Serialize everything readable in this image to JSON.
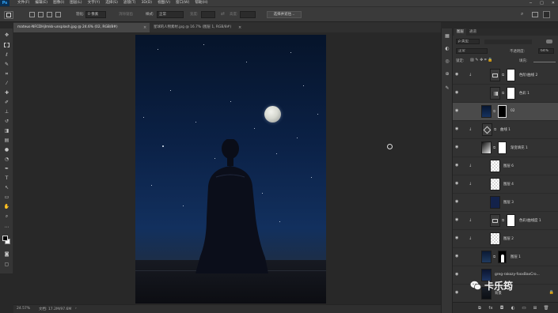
{
  "app": {
    "logo": "Ps"
  },
  "menu": [
    "文件(F)",
    "编辑(E)",
    "图像(I)",
    "图层(L)",
    "文字(Y)",
    "选择(S)",
    "滤镜(T)",
    "3D(D)",
    "视图(V)",
    "窗口(W)",
    "帮助(H)"
  ],
  "window_controls": [
    "─",
    "□",
    "✕"
  ],
  "options": {
    "feather_label": "羽化:",
    "feather_value": "0 像素",
    "antialias_label": "消除锯齿",
    "style_label": "样式:",
    "style_value": "正常",
    "width_label": "宽度:",
    "height_label": "高度:",
    "select_mask_button": "选择并遮住..."
  },
  "tabs": [
    {
      "title": "mateus-NFCDHjlmkk-unsplash.jpg @ 24.6% (02, RGB/8#)",
      "close": "×"
    },
    {
      "title": "星球的人物素材.jpg @ 16.7% (图层 1, RGB/8#)",
      "close": "×"
    }
  ],
  "status": {
    "zoom": "24.57%",
    "doc": "文档: 17.2M/97.6M",
    "arrow": "›"
  },
  "panel": {
    "tabs": [
      "图层",
      "通道"
    ],
    "kind_filter": "ρ 类型",
    "blend_mode": "正常",
    "opacity_label": "不透明度:",
    "opacity_value": "64%",
    "lock_label": "锁定:",
    "fill_label": "填充:",
    "fill_value": "100%",
    "layers": [
      {
        "name": "色阶/曲线 2",
        "thumb": "adjust",
        "mask": "white",
        "clip": "↓",
        "selected": false
      },
      {
        "name": "色彩 1",
        "thumb": "adjust2",
        "mask": "white",
        "clip": "",
        "selected": false
      },
      {
        "name": "02",
        "thumb": "photo",
        "mask": "black",
        "clip": "",
        "selected": true
      },
      {
        "name": "曲线 1",
        "thumb": "adjust",
        "mask": "",
        "clip": "↓",
        "selected": false
      },
      {
        "name": "渐变填充 1",
        "thumb": "gradient",
        "mask": "white",
        "clip": "",
        "selected": false
      },
      {
        "name": "图层 6",
        "thumb": "checker",
        "mask": "",
        "clip": "↓",
        "selected": false
      },
      {
        "name": "图层 4",
        "thumb": "checker",
        "mask": "",
        "clip": "↓",
        "selected": false
      },
      {
        "name": "图层 3",
        "thumb": "navy",
        "mask": "",
        "clip": "",
        "selected": false
      },
      {
        "name": "色彩/曲线度 1",
        "thumb": "adjust",
        "mask": "white",
        "clip": "↓",
        "selected": false
      },
      {
        "name": "图层 2",
        "thumb": "checker",
        "mask": "",
        "clip": "↓",
        "selected": false
      },
      {
        "name": "图层 1",
        "thumb": "figure",
        "mask": "figure",
        "clip": "",
        "selected": false
      },
      {
        "name": "greg-rakozy-foxxBaxCro...",
        "thumb": "sky",
        "mask": "",
        "clip": "",
        "selected": false
      },
      {
        "name": "背景",
        "thumb": "dark",
        "mask": "",
        "clip": "",
        "selected": false,
        "locked": true
      }
    ],
    "footer_icons": [
      "link-icon",
      "fx-icon",
      "mask-icon",
      "adjustment-icon",
      "folder-icon",
      "new-layer-icon",
      "trash-icon"
    ]
  },
  "watermark": {
    "text": "卡乐筠"
  }
}
